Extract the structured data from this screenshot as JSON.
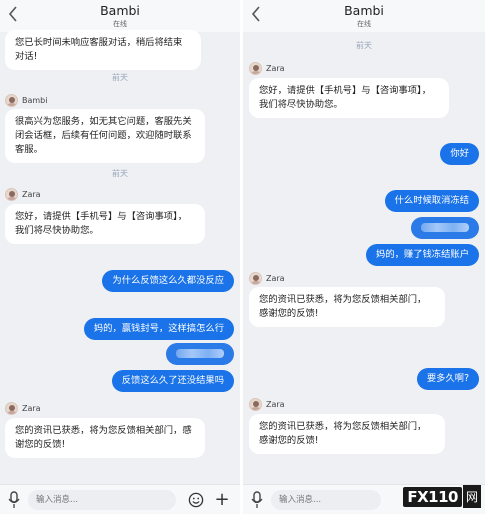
{
  "left": {
    "header": {
      "title": "Bambi",
      "status": "在线"
    },
    "top_bubble": "您已长时间未响应客服对话，稍后将结束对话!",
    "sep1": "前天",
    "sender1": "Bambi",
    "bubble_bambi": "很高兴为您服务，如无其它问题，客服先关闭会话框，后续有任何问题，欢迎随时联系客服。",
    "sep2": "前天",
    "sender2": "Zara",
    "bubble_zara1": "您好，请提供【手机号】与【咨询事项】，我们将尽快协助您。",
    "mine1": "为什么反馈这么久都没反应",
    "mine2": "妈的，赢钱封号，这样搞怎么行",
    "mine4": "反馈这么久了还没结果吗",
    "sender3": "Zara",
    "bubble_zara2": "您的资讯已获悉，将为您反馈相关部门，感谢您的反馈!",
    "input_placeholder": "输入消息..."
  },
  "right": {
    "header": {
      "title": "Bambi",
      "status": "在线"
    },
    "sep1": "前天",
    "sender1": "Zara",
    "bubble_zara1": "您好，请提供【手机号】与【咨询事项】，我们将尽快协助您。",
    "mine1": "你好",
    "mine2": "什么时候取消冻结",
    "mine4": "妈的，赚了钱冻结账户",
    "sender2": "Zara",
    "bubble_zara2": "您的资讯已获悉，将为您反馈相关部门，感谢您的反馈!",
    "mine5": "要多久啊?",
    "sender3": "Zara",
    "bubble_zara3": "您的资讯已获悉，将为您反馈相关部门，感谢您的反馈!",
    "input_placeholder": "输入消息..."
  },
  "watermark": {
    "text": "FX110",
    "cn": "网"
  },
  "colors": {
    "accent": "#1a73e8",
    "panel_bg": "#eef0f3",
    "bubble_bg": "#ffffff"
  }
}
